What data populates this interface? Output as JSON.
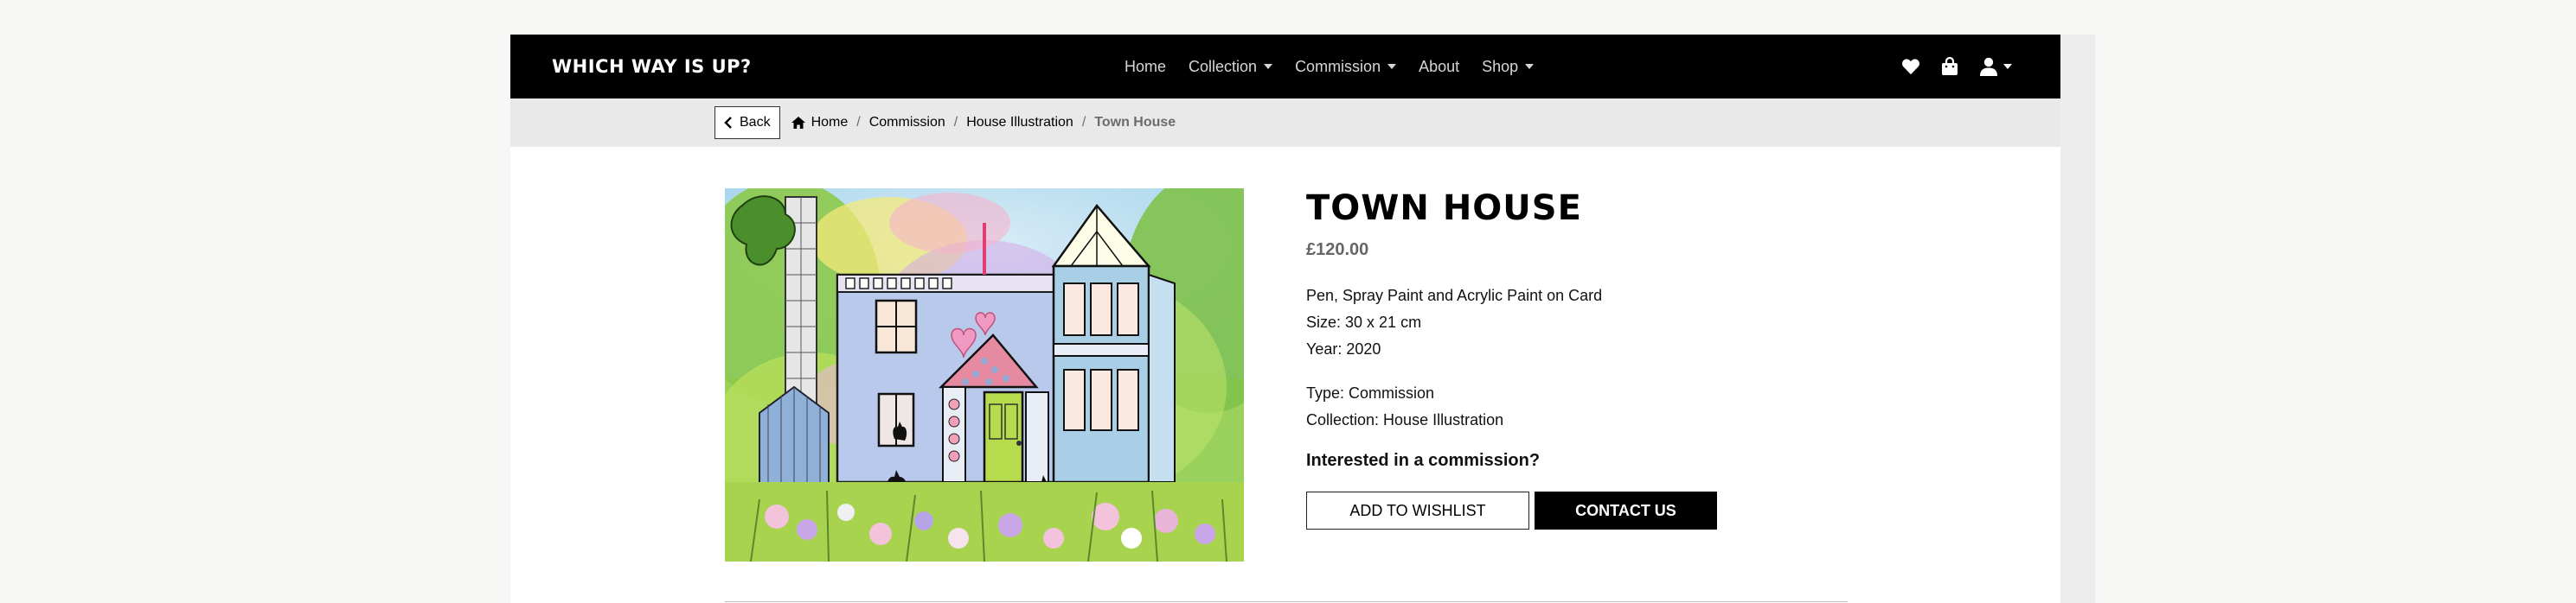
{
  "brand": "WHICH WAY IS UP?",
  "nav": {
    "home": "Home",
    "collection": "Collection",
    "commission": "Commission",
    "about": "About",
    "shop": "Shop"
  },
  "breadcrumb": {
    "back": "Back",
    "home": "Home",
    "commission": "Commission",
    "collection": "House Illustration",
    "current": "Town House"
  },
  "product": {
    "title": "TOWN HOUSE",
    "price": "£120.00",
    "medium": "Pen, Spray Paint and Acrylic Paint on Card",
    "size": "Size: 30 x 21 cm",
    "year": "Year: 2020",
    "type": "Type: Commission",
    "collection": "Collection: House Illustration",
    "cta": "Interested in a commission?",
    "wishlist_label": "ADD TO WISHLIST",
    "contact_label": "CONTACT US"
  },
  "icons": {
    "wishlist": "heart-icon",
    "bag": "shopping-bag-icon",
    "user": "user-icon",
    "back": "chevron-left-icon",
    "home": "home-icon"
  },
  "colors": {
    "navbar": "#000000",
    "breadcrumb_bg": "#e9e9e9",
    "price": "#666666",
    "primary_button": "#000000"
  }
}
